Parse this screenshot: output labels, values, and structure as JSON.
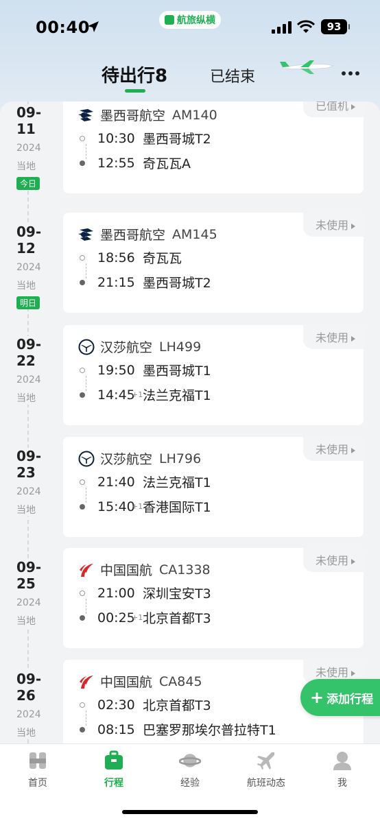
{
  "status_bar": {
    "time": "00:40",
    "app_name": "航旅纵横",
    "battery": "93"
  },
  "tabs": [
    {
      "label": "待出行8",
      "active": true
    },
    {
      "label": "已结束",
      "active": false
    }
  ],
  "trips": [
    {
      "date": "09-11",
      "year": "2024",
      "local": "当地",
      "badge": "今日",
      "airline": "墨西哥航空",
      "airline_logo": "aeromexico-logo",
      "flight": "AM140",
      "status": "已值机",
      "dep_time": "10:30",
      "dep_place": "墨西哥城T2",
      "arr_time": "12:55",
      "arr_plus": "",
      "arr_place": "奇瓦瓦A"
    },
    {
      "date": "09-12",
      "year": "2024",
      "local": "当地",
      "badge": "明日",
      "airline": "墨西哥航空",
      "airline_logo": "aeromexico-logo",
      "flight": "AM145",
      "status": "未使用",
      "dep_time": "18:56",
      "dep_place": "奇瓦瓦",
      "arr_time": "21:15",
      "arr_plus": "",
      "arr_place": "墨西哥城T2"
    },
    {
      "date": "09-22",
      "year": "2024",
      "local": "当地",
      "badge": "",
      "airline": "汉莎航空",
      "airline_logo": "lufthansa-logo",
      "flight": "LH499",
      "status": "未使用",
      "dep_time": "19:50",
      "dep_place": "墨西哥城T1",
      "arr_time": "14:45",
      "arr_plus": "+1",
      "arr_place": "法兰克福T1"
    },
    {
      "date": "09-23",
      "year": "2024",
      "local": "当地",
      "badge": "",
      "airline": "汉莎航空",
      "airline_logo": "lufthansa-logo",
      "flight": "LH796",
      "status": "未使用",
      "dep_time": "21:40",
      "dep_place": "法兰克福T1",
      "arr_time": "15:40",
      "arr_plus": "+1",
      "arr_place": "香港国际T1"
    },
    {
      "date": "09-25",
      "year": "2024",
      "local": "当地",
      "badge": "",
      "airline": "中国国航",
      "airline_logo": "air-china-logo",
      "flight": "CA1338",
      "status": "未使用",
      "dep_time": "21:00",
      "dep_place": "深圳宝安T3",
      "arr_time": "00:25",
      "arr_plus": "+1",
      "arr_place": "北京首都T3"
    },
    {
      "date": "09-26",
      "year": "2024",
      "local": "当地",
      "badge": "",
      "airline": "中国国航",
      "airline_logo": "air-china-logo",
      "flight": "CA845",
      "status": "未使用",
      "dep_time": "02:30",
      "dep_place": "北京首都T3",
      "arr_time": "08:15",
      "arr_plus": "",
      "arr_place": "巴塞罗那埃尔普拉特T1"
    }
  ],
  "fab": {
    "label": "添加行程"
  },
  "nav": [
    {
      "label": "首页",
      "icon": "home-icon",
      "active": false
    },
    {
      "label": "行程",
      "icon": "suitcase-icon",
      "active": true
    },
    {
      "label": "经验",
      "icon": "planet-icon",
      "active": false
    },
    {
      "label": "航班动态",
      "icon": "plane-icon",
      "active": false
    },
    {
      "label": "我",
      "icon": "user-icon",
      "active": false
    }
  ],
  "colors": {
    "accent": "#1fae52",
    "fab": "#34c26b",
    "air_china": "#d8262c",
    "aeromexico": "#0b2343",
    "lufthansa": "#0a1d3d"
  }
}
